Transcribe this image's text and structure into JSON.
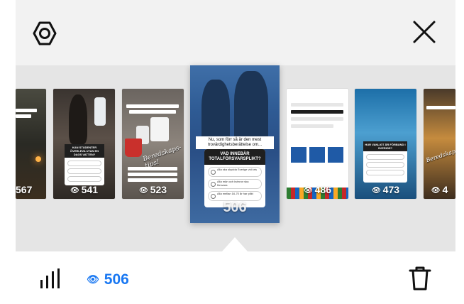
{
  "toolbar": {
    "settings_icon": "gear-icon",
    "close_icon": "close-icon"
  },
  "stories": [
    {
      "views": "567"
    },
    {
      "views": "541",
      "banner": "KAN STUDENTER ÖVERLEVA UTAN EN DAGS VATTEN?"
    },
    {
      "views": "523",
      "sticker": "Beredskaps-tips!"
    },
    {
      "views": "506",
      "selected": true,
      "caption": "Nu, som förr så är den mest trovärdighetsberättelse om...",
      "poll": {
        "question": "VAD INNEBÄR TOTALFÖRSVARSPLIKT?",
        "options": [
          "Alla ska skydda Sverige vid kris",
          "Alla män och kvinnor ska försvara",
          "Alla mellan 16-70 år har plikt"
        ]
      }
    },
    {
      "views": "486"
    },
    {
      "views": "473",
      "banner": "HUR VANLIGT ÄR FÖRBUND I SVERIGE?"
    },
    {
      "views": "4",
      "sticker": "Beredskaps-tips!"
    }
  ],
  "footer": {
    "insights_icon": "bar-chart-icon",
    "views_icon": "eye-icon",
    "views_count": "506",
    "delete_icon": "trash-icon"
  },
  "colors": {
    "accent": "#1877f2",
    "strip_bg": "#e5e5e5",
    "topbar_bg": "#f2f2f2"
  }
}
